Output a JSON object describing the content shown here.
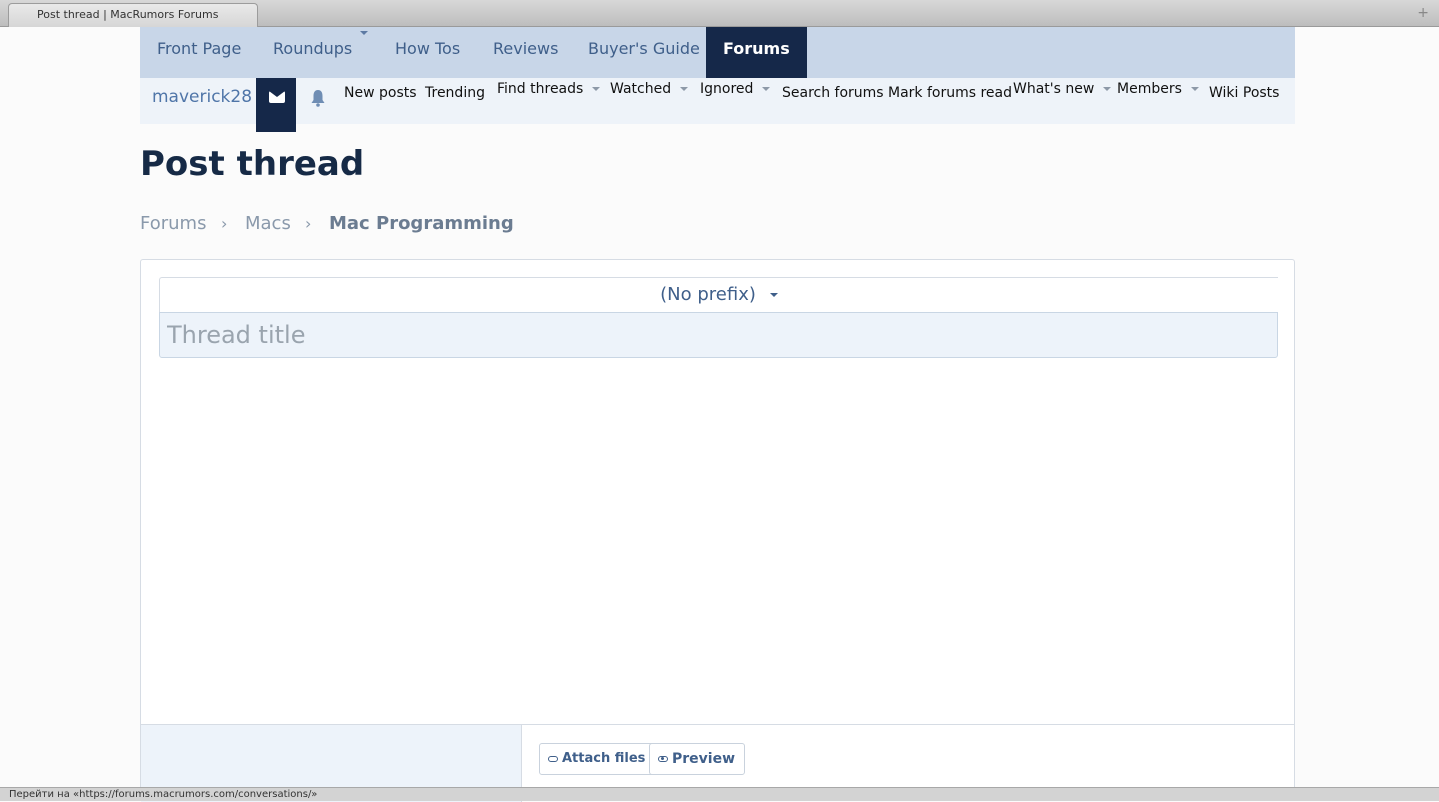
{
  "browser": {
    "tab_title": "Post thread | MacRumors Forums",
    "new_tab_symbol": "+",
    "status_text": "Перейти на «https://forums.macrumors.com/conversations/»"
  },
  "topnav": {
    "items": [
      "Front Page",
      "Roundups",
      "How Tos",
      "Reviews",
      "Buyer's Guide",
      "Forums"
    ],
    "active": "Forums"
  },
  "subnav": {
    "username": "maverick28",
    "links": [
      "New posts",
      "Trending",
      "Find threads",
      "Watched",
      "Ignored",
      "Search forums",
      "Mark forums read",
      "What's new",
      "Members",
      "Wiki Posts"
    ]
  },
  "page": {
    "title": "Post thread"
  },
  "breadcrumb": {
    "items": [
      "Forums",
      "Macs",
      "Mac Programming"
    ],
    "separator": "›"
  },
  "editor": {
    "prefix_value": "(No prefix)",
    "title_placeholder": "Thread title",
    "attach_label": "Attach files",
    "preview_label": "Preview"
  },
  "colors": {
    "nav_bg": "#c8d6e8",
    "nav_active": "#152849",
    "link": "#3f5f8a",
    "title": "#162a46"
  }
}
